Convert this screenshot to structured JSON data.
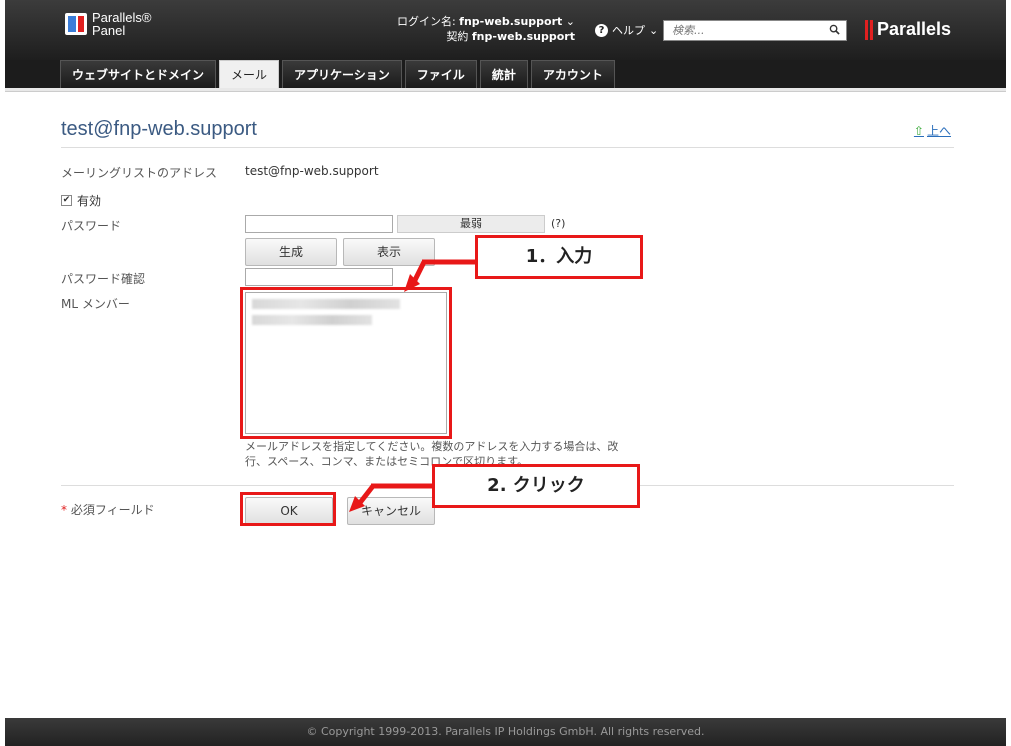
{
  "header": {
    "logo_line1": "Parallels®",
    "logo_line2": "Panel",
    "login_label": "ログイン名: ",
    "login_value": "fnp-web.support",
    "contract_label": "契約 ",
    "contract_value": "fnp-web.support",
    "help_label": "ヘルプ",
    "search_placeholder": "検索...",
    "brand": "Parallels"
  },
  "tabs": [
    {
      "label": "ウェブサイトとドメイン",
      "active": false
    },
    {
      "label": "メール",
      "active": true
    },
    {
      "label": "アプリケーション",
      "active": false
    },
    {
      "label": "ファイル",
      "active": false
    },
    {
      "label": "統計",
      "active": false
    },
    {
      "label": "アカウント",
      "active": false
    }
  ],
  "page": {
    "title": "test@fnp-web.support",
    "up_label": "上へ"
  },
  "form": {
    "address_label": "メーリングリストのアドレス",
    "address_value": "test@fnp-web.support",
    "enabled_label": "有効",
    "password_label": "パスワード",
    "strength_label": "最弱",
    "strength_hint": "(?)",
    "generate_label": "生成",
    "show_label": "表示",
    "confirm_label": "パスワード確認",
    "members_label": "ML メンバー",
    "members_help": "メールアドレスを指定してください。複数のアドレスを入力する場合は、改行、スペース、コンマ、またはセミコロンで区切ります。",
    "required_label": "必須フィールド",
    "required_mark": "*",
    "ok_label": "OK",
    "cancel_label": "キャンセル"
  },
  "annotations": {
    "step1": "1．入力",
    "step2": "2. クリック",
    "color": "#e81818"
  },
  "footer": {
    "copyright": "© Copyright 1999-2013. Parallels IP Holdings GmbH. All rights reserved."
  }
}
